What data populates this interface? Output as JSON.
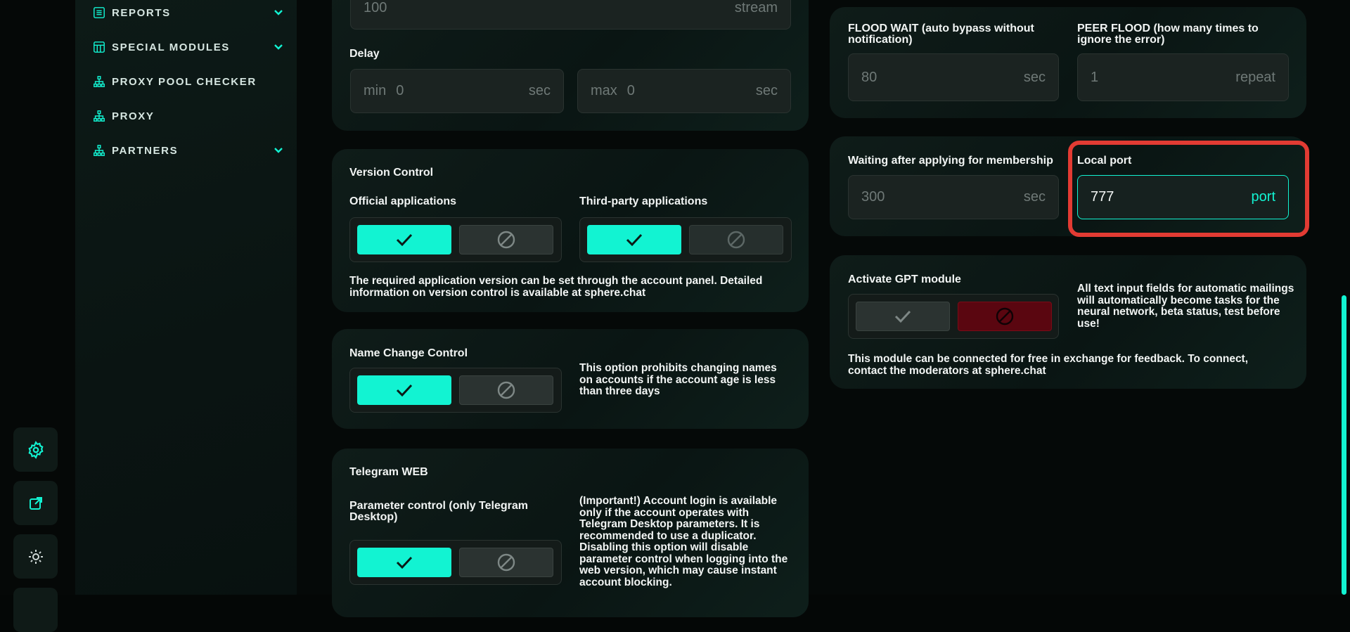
{
  "sidebar": {
    "items": [
      {
        "label": "REPORTS",
        "icon": "report-icon",
        "has_chevron": true
      },
      {
        "label": "SPECIAL MODULES",
        "icon": "modules-icon",
        "has_chevron": true
      },
      {
        "label": "PROXY POOL CHECKER",
        "icon": "network-icon",
        "has_chevron": false
      },
      {
        "label": "PROXY",
        "icon": "network-icon",
        "has_chevron": false
      },
      {
        "label": "PARTNERS",
        "icon": "network-icon",
        "has_chevron": true
      }
    ]
  },
  "rail": {
    "buttons": [
      {
        "icon": "settings-gear-icon"
      },
      {
        "icon": "external-link-icon"
      },
      {
        "icon": "theme-sun-icon"
      }
    ]
  },
  "threads": {
    "value": "100",
    "unit": "stream"
  },
  "delay": {
    "label": "Delay",
    "min": {
      "prefix": "min",
      "value": "0",
      "unit": "sec"
    },
    "max": {
      "prefix": "max",
      "value": "0",
      "unit": "sec"
    }
  },
  "version_control": {
    "title": "Version Control",
    "official": {
      "label": "Official applications",
      "state": "enabled"
    },
    "third_party": {
      "label": "Third-party applications",
      "state": "enabled"
    },
    "note": "The required application version can be set through the account panel. Detailed information on version control is available at sphere.chat"
  },
  "name_change": {
    "title": "Name Change Control",
    "state": "enabled",
    "note": "This option prohibits changing names on accounts if the account age is less than three days"
  },
  "telegram_web": {
    "title": "Telegram WEB",
    "param_label": "Parameter control (only Telegram Desktop)",
    "state": "enabled",
    "note": "(Important!) Account login is available only if the account operates with Telegram Desktop parameters. It is recommended to use a duplicator. Disabling this option will disable parameter control when logging into the web version, which may cause instant account blocking."
  },
  "flood": {
    "flood_wait": {
      "label": "FLOOD WAIT (auto bypass without notification)",
      "value": "80",
      "unit": "sec"
    },
    "peer_flood": {
      "label": "PEER FLOOD (how many times to ignore the error)",
      "value": "1",
      "unit": "repeat"
    }
  },
  "membership": {
    "waiting": {
      "label": "Waiting after applying for membership",
      "value": "300",
      "unit": "sec"
    },
    "local_port": {
      "label": "Local port",
      "value": "777",
      "unit": "port"
    }
  },
  "gpt": {
    "title": "Activate GPT module",
    "state": "disabled",
    "side_note": "All text input fields for automatic mailings will automatically become tasks for the neural network, beta status, test before use!",
    "note": "This module can be connected for free in exchange for feedback. To connect, contact the moderators at sphere.chat"
  },
  "colors": {
    "accent": "#12f3d2",
    "highlight": "#e23b33",
    "danger": "#5a0610"
  }
}
